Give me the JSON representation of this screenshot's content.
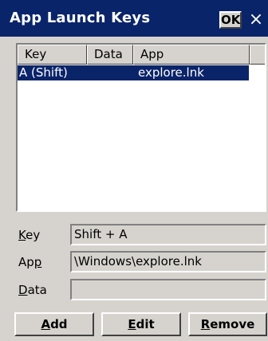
{
  "window": {
    "title": "App Launch Keys",
    "ok_label": "OK",
    "close_label": "×"
  },
  "list": {
    "columns": [
      "Key",
      "Data",
      "App"
    ],
    "rows": [
      {
        "key": "A (Shift)",
        "data": "",
        "app": "explore.lnk"
      }
    ]
  },
  "form": {
    "key": {
      "label_underlined": "K",
      "label_rest": "ey",
      "value": "Shift + A"
    },
    "app": {
      "label_prefix": "Ap",
      "label_underlined": "p",
      "value": "\\Windows\\explore.lnk"
    },
    "data": {
      "label_underlined": "D",
      "label_rest": "ata",
      "value": ""
    }
  },
  "buttons": {
    "add": {
      "underlined": "A",
      "rest": "dd"
    },
    "edit": {
      "underlined": "E",
      "rest": "dit"
    },
    "remove": {
      "underlined": "R",
      "rest": "emove"
    }
  }
}
